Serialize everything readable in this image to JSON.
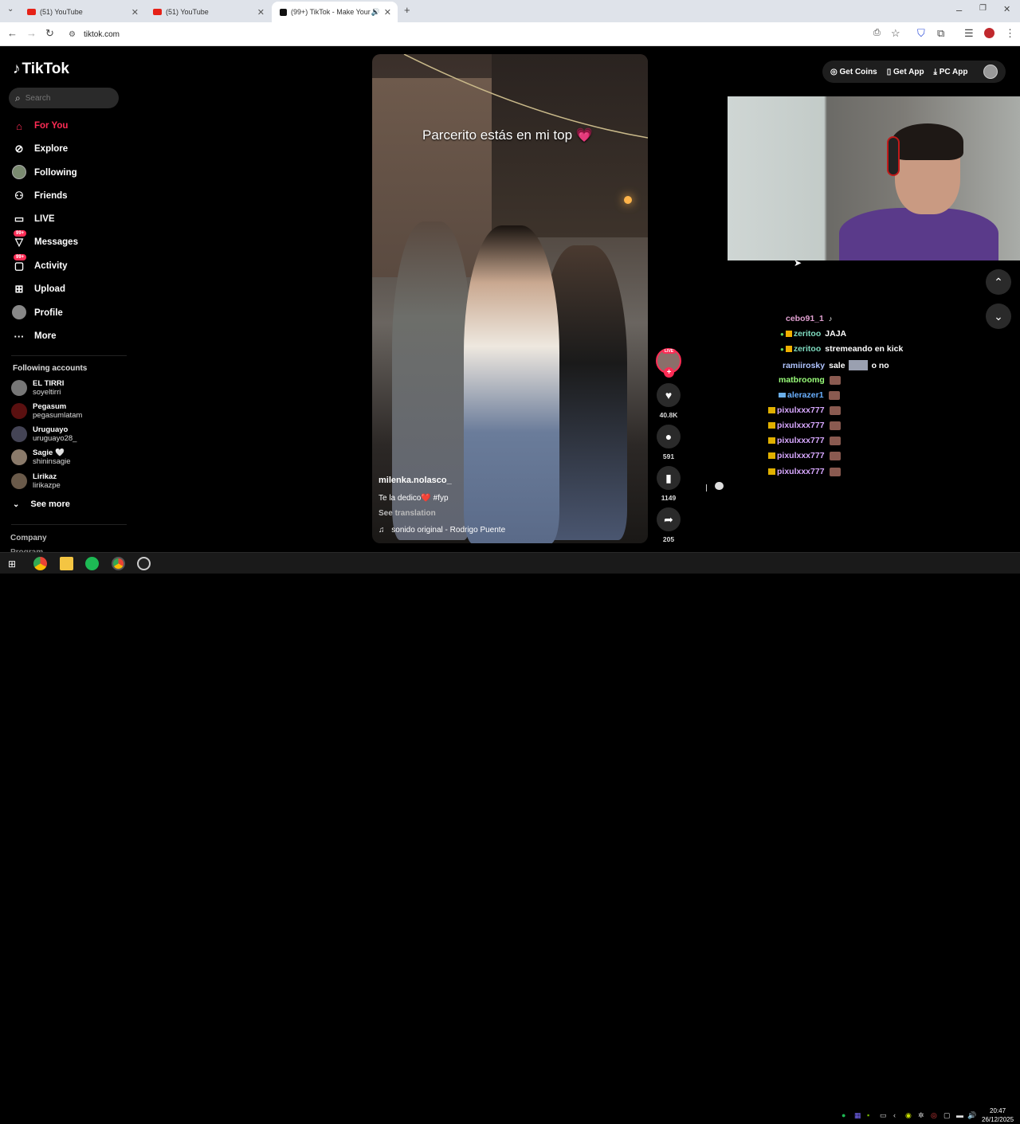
{
  "browser": {
    "tabs": [
      {
        "title": "(51) YouTube",
        "active": false
      },
      {
        "title": "(51) YouTube",
        "active": false
      },
      {
        "title": "(99+) TikTok - Make Your Day",
        "active": true
      }
    ],
    "url": "tiktok.com"
  },
  "tiktok": {
    "logo": "TikTok",
    "search_placeholder": "Search",
    "nav": [
      {
        "label": "For You",
        "icon": "home-icon",
        "active": true
      },
      {
        "label": "Explore",
        "icon": "compass-icon"
      },
      {
        "label": "Following",
        "icon": "following-avatar-icon"
      },
      {
        "label": "Friends",
        "icon": "friends-icon"
      },
      {
        "label": "LIVE",
        "icon": "live-icon"
      },
      {
        "label": "Messages",
        "icon": "messages-icon",
        "badge": "99+"
      },
      {
        "label": "Activity",
        "icon": "activity-icon",
        "badge": "99+"
      },
      {
        "label": "Upload",
        "icon": "upload-icon"
      },
      {
        "label": "Profile",
        "icon": "profile-icon"
      },
      {
        "label": "More",
        "icon": "more-icon"
      }
    ],
    "following_title": "Following accounts",
    "following": [
      {
        "name": "EL TIRRI",
        "handle": "soyeltirri"
      },
      {
        "name": "Pegasum",
        "handle": "pegasumlatam"
      },
      {
        "name": "Uruguayo",
        "handle": "uruguayo28_"
      },
      {
        "name": "Sagie 🤍",
        "handle": "shininsagie"
      },
      {
        "name": "Lirikaz",
        "handle": "lirikazpe"
      }
    ],
    "see_more": "See more",
    "company": "Company",
    "program": "Program",
    "top_actions": {
      "coins": "Get Coins",
      "app": "Get App",
      "pc": "PC App"
    },
    "video": {
      "caption": "Parcerito estás en mi top 💗",
      "author": "milenka.nolasco_",
      "description": "Te la dedico❤️ #fyp",
      "see_translation": "See translation",
      "sound": "sonido original - Rodrigo Puente",
      "live_tag": "LIVE",
      "likes": "40.8K",
      "comments": "591",
      "saves": "1149",
      "shares": "205"
    }
  },
  "chat": [
    {
      "user": "cebo91_1",
      "color": "#e0a0d0",
      "msg": ""
    },
    {
      "user": "zeritoo",
      "color": "#7fdcc0",
      "msg": "JAJA"
    },
    {
      "user": "zeritoo",
      "color": "#7fdcc0",
      "msg": "stremeando en kick"
    },
    {
      "user": "ramiirosky",
      "color": "#b0c4ff",
      "msg": "sale",
      "msg2": "o no"
    },
    {
      "user": "matbroomg",
      "color": "#9aff7a",
      "msg": ""
    },
    {
      "user": "alerazer1",
      "color": "#6ab0ff",
      "msg": ""
    },
    {
      "user": "pixulxxx777",
      "color": "#d8a8ff",
      "msg": ""
    },
    {
      "user": "pixulxxx777",
      "color": "#d8a8ff",
      "msg": ""
    },
    {
      "user": "pixulxxx777",
      "color": "#d8a8ff",
      "msg": ""
    },
    {
      "user": "pixulxxx777",
      "color": "#d8a8ff",
      "msg": ""
    },
    {
      "user": "pixulxxx777",
      "color": "#d8a8ff",
      "msg": ""
    }
  ],
  "taskbar": {
    "time": "20:47",
    "date": "26/12/2025"
  },
  "colors": {
    "accent": "#fe2c55"
  }
}
